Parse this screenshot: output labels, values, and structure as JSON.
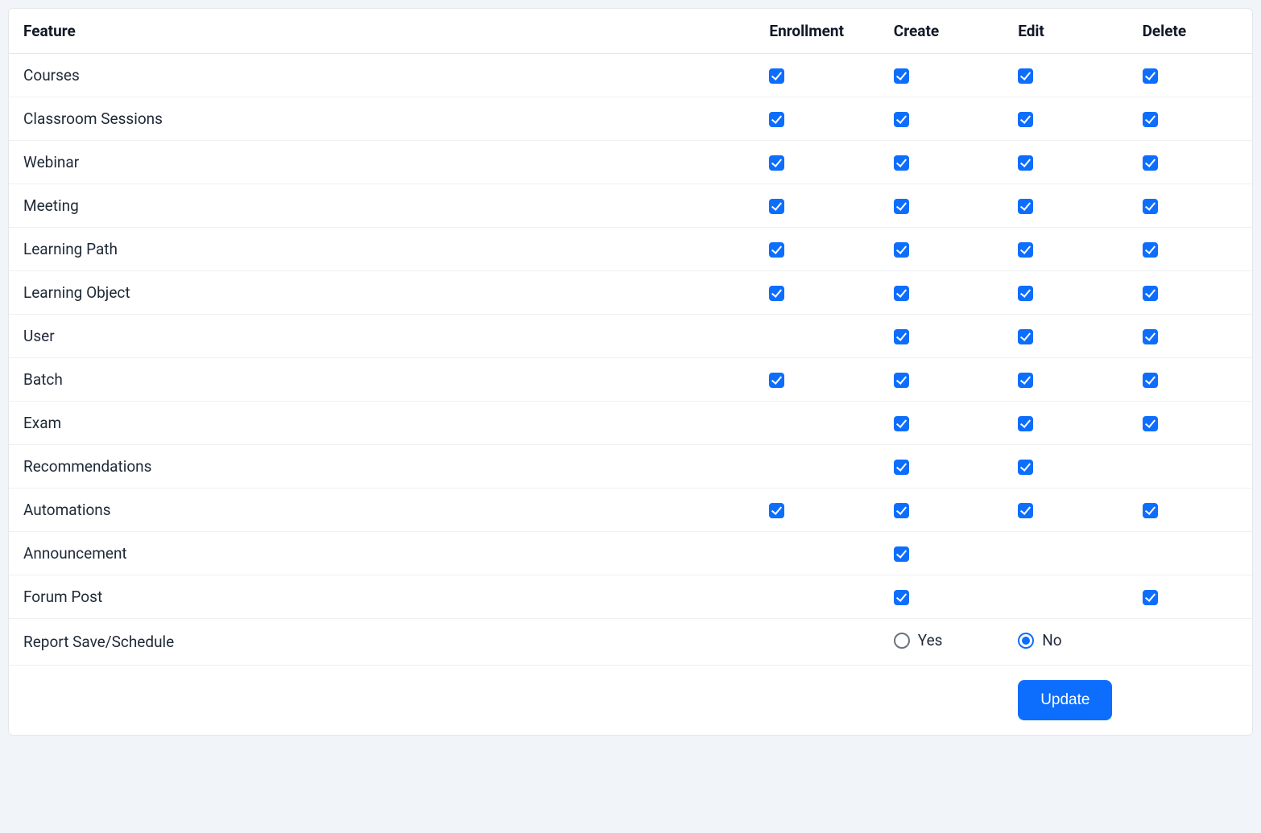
{
  "columns": {
    "feature": "Feature",
    "enrollment": "Enrollment",
    "create": "Create",
    "edit": "Edit",
    "delete": "Delete"
  },
  "rows": [
    {
      "feature": "Courses",
      "enrollment": true,
      "create": true,
      "edit": true,
      "delete": true
    },
    {
      "feature": "Classroom Sessions",
      "enrollment": true,
      "create": true,
      "edit": true,
      "delete": true
    },
    {
      "feature": "Webinar",
      "enrollment": true,
      "create": true,
      "edit": true,
      "delete": true
    },
    {
      "feature": "Meeting",
      "enrollment": true,
      "create": true,
      "edit": true,
      "delete": true
    },
    {
      "feature": "Learning Path",
      "enrollment": true,
      "create": true,
      "edit": true,
      "delete": true
    },
    {
      "feature": "Learning Object",
      "enrollment": true,
      "create": true,
      "edit": true,
      "delete": true
    },
    {
      "feature": "User",
      "enrollment": null,
      "create": true,
      "edit": true,
      "delete": true
    },
    {
      "feature": "Batch",
      "enrollment": true,
      "create": true,
      "edit": true,
      "delete": true
    },
    {
      "feature": "Exam",
      "enrollment": null,
      "create": true,
      "edit": true,
      "delete": true
    },
    {
      "feature": "Recommendations",
      "enrollment": null,
      "create": true,
      "edit": true,
      "delete": null
    },
    {
      "feature": "Automations",
      "enrollment": true,
      "create": true,
      "edit": true,
      "delete": true
    },
    {
      "feature": "Announcement",
      "enrollment": null,
      "create": true,
      "edit": null,
      "delete": null
    },
    {
      "feature": "Forum Post",
      "enrollment": null,
      "create": true,
      "edit": null,
      "delete": true
    }
  ],
  "report_row": {
    "feature": "Report Save/Schedule",
    "yes_label": "Yes",
    "no_label": "No",
    "selected": "no"
  },
  "buttons": {
    "update": "Update"
  }
}
